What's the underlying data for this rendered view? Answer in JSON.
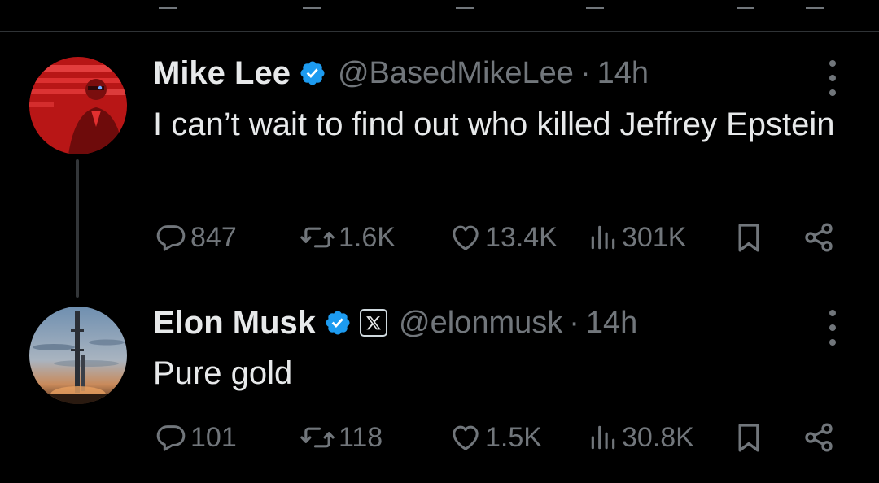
{
  "colors": {
    "background": "#000000",
    "text": "#e7e9ea",
    "secondary": "#71767b",
    "verified": "#1d9bf0",
    "divider": "#2f3336"
  },
  "tweets": [
    {
      "name": "Mike Lee",
      "handle": "@BasedMikeLee",
      "separator": "·",
      "time": "14h",
      "text": "I can’t wait to find out who killed Jeffrey Epstein",
      "verified": true,
      "affiliation_icon": null,
      "stats": {
        "replies": "847",
        "reposts": "1.6K",
        "likes": "13.4K",
        "views": "301K"
      }
    },
    {
      "name": "Elon Musk",
      "handle": "@elonmusk",
      "separator": "·",
      "time": "14h",
      "text": "Pure gold",
      "verified": true,
      "affiliation_icon": "x-logo-icon",
      "stats": {
        "replies": "101",
        "reposts": "118",
        "likes": "1.5K",
        "views": "30.8K"
      }
    }
  ],
  "icons": {
    "reply": "reply-bubble-icon",
    "repost": "repost-arrows-icon",
    "like": "heart-icon",
    "views": "analytics-bars-icon",
    "bookmark": "bookmark-icon",
    "share": "share-nodes-icon",
    "more": "more-vertical-icon"
  }
}
